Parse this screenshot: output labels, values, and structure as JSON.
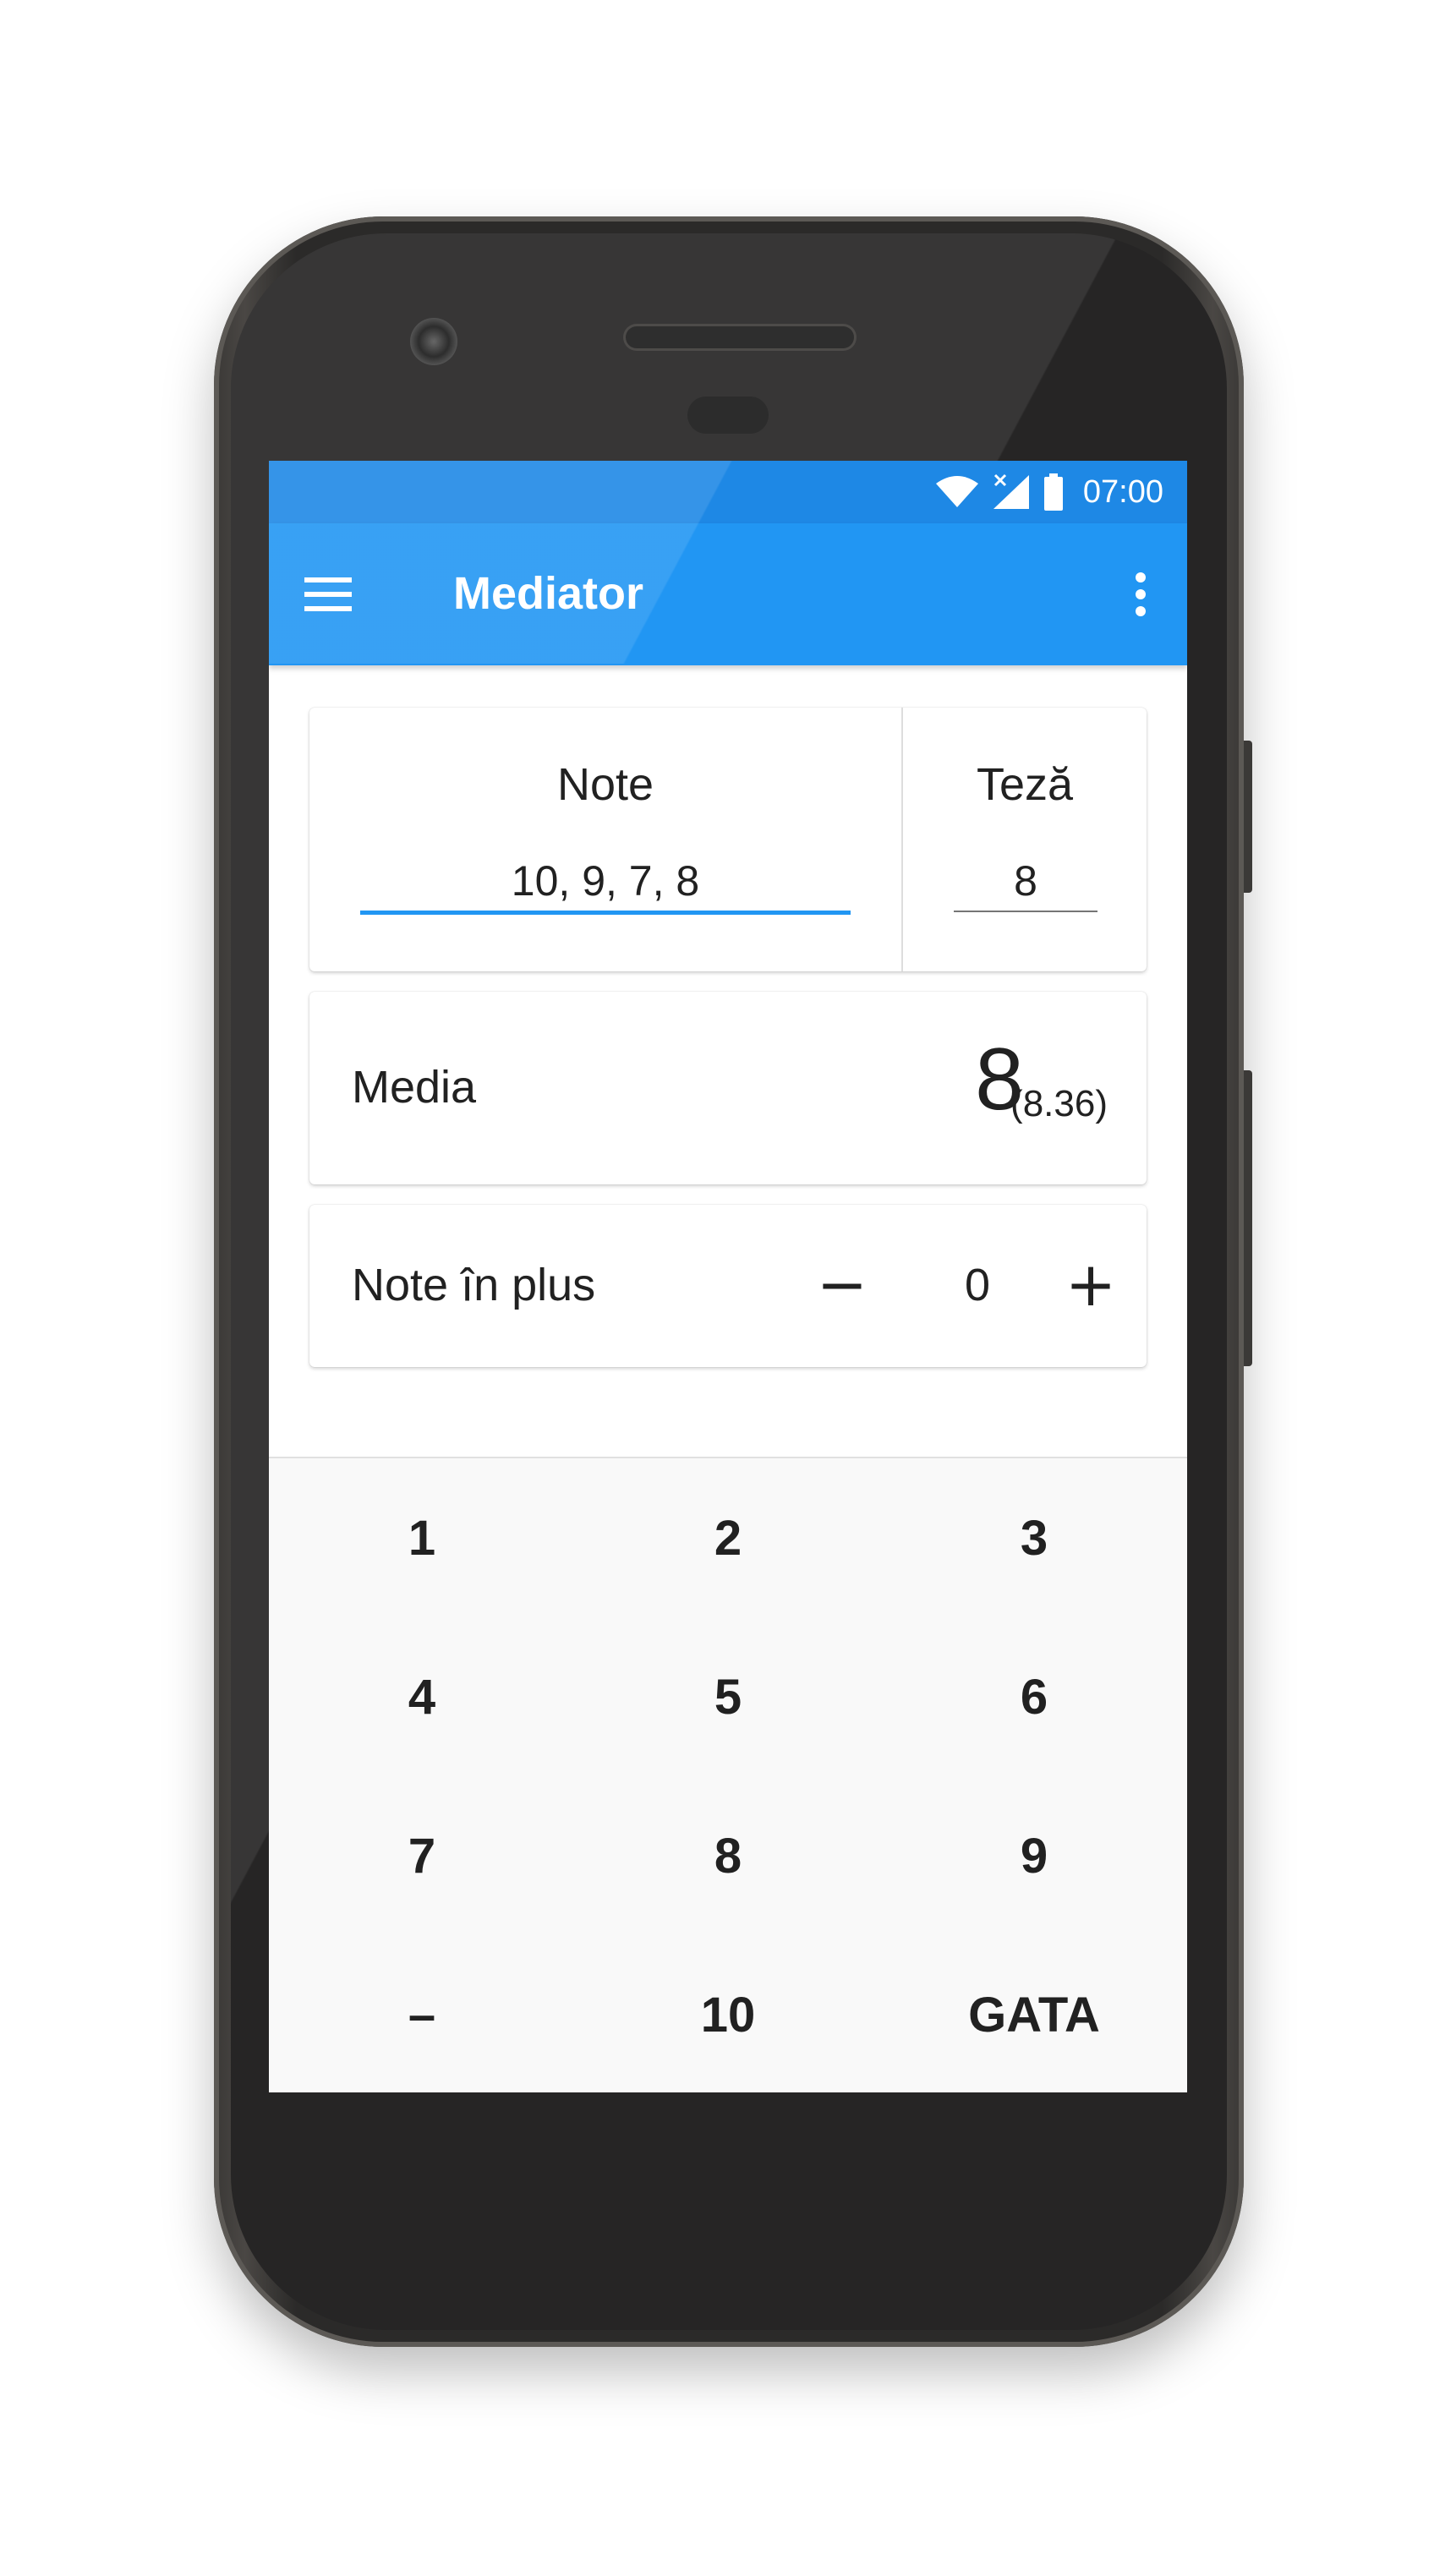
{
  "status_bar": {
    "time": "07:00",
    "icons": [
      "wifi-icon",
      "signal-no-data-icon",
      "battery-icon"
    ]
  },
  "app_bar": {
    "title": "Mediator",
    "menu_icon": "hamburger-menu-icon",
    "overflow_icon": "more-vert-icon"
  },
  "inputs": {
    "note_label": "Note",
    "note_value": "10, 9, 7, 8",
    "teza_label": "Teză",
    "teza_value": "8"
  },
  "media": {
    "label": "Media",
    "value": "8",
    "exact": "(8.36)"
  },
  "extra": {
    "label": "Note în plus",
    "minus_label": "−",
    "value": "0",
    "plus_label": "+"
  },
  "keypad": {
    "keys": [
      "1",
      "2",
      "3",
      "4",
      "5",
      "6",
      "7",
      "8",
      "9",
      "–",
      "10",
      "GATA"
    ]
  },
  "colors": {
    "status_bar": "#1e88e5",
    "app_bar": "#2196f3",
    "accent": "#2196f3",
    "keypad_bg": "#f9f9f9"
  }
}
